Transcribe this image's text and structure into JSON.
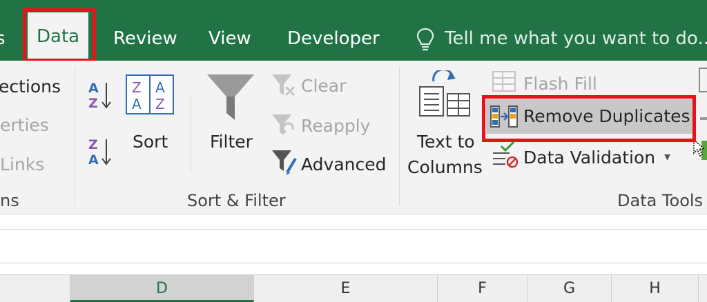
{
  "tabs": {
    "partial": "s",
    "data": "Data",
    "review": "Review",
    "view": "View",
    "developer": "Developer"
  },
  "tell_me": {
    "placeholder": "Tell me what you want to do..."
  },
  "connections": {
    "connections_label": "ections",
    "properties_label": "erties",
    "edit_links_label": "Links",
    "group_label": "ns"
  },
  "sort_filter": {
    "sort_az_label": "A↓Z",
    "sort_za_label": "Z↓A",
    "sort_label": "Sort",
    "filter_label": "Filter",
    "clear_label": "Clear",
    "reapply_label": "Reapply",
    "advanced_label": "Advanced",
    "group_label": "Sort & Filter"
  },
  "data_tools": {
    "text_to_columns_line1": "Text to",
    "text_to_columns_line2": "Columns",
    "flash_fill_label": "Flash Fill",
    "remove_duplicates_label": "Remove Duplicates",
    "data_validation_label": "Data Validation",
    "data_validation_arrow": "▾",
    "group_label": "Data Tools"
  },
  "columns": [
    "D",
    "E",
    "F",
    "G",
    "H"
  ],
  "colors": {
    "excel_green": "#217346",
    "highlight_red": "#e8121a"
  }
}
